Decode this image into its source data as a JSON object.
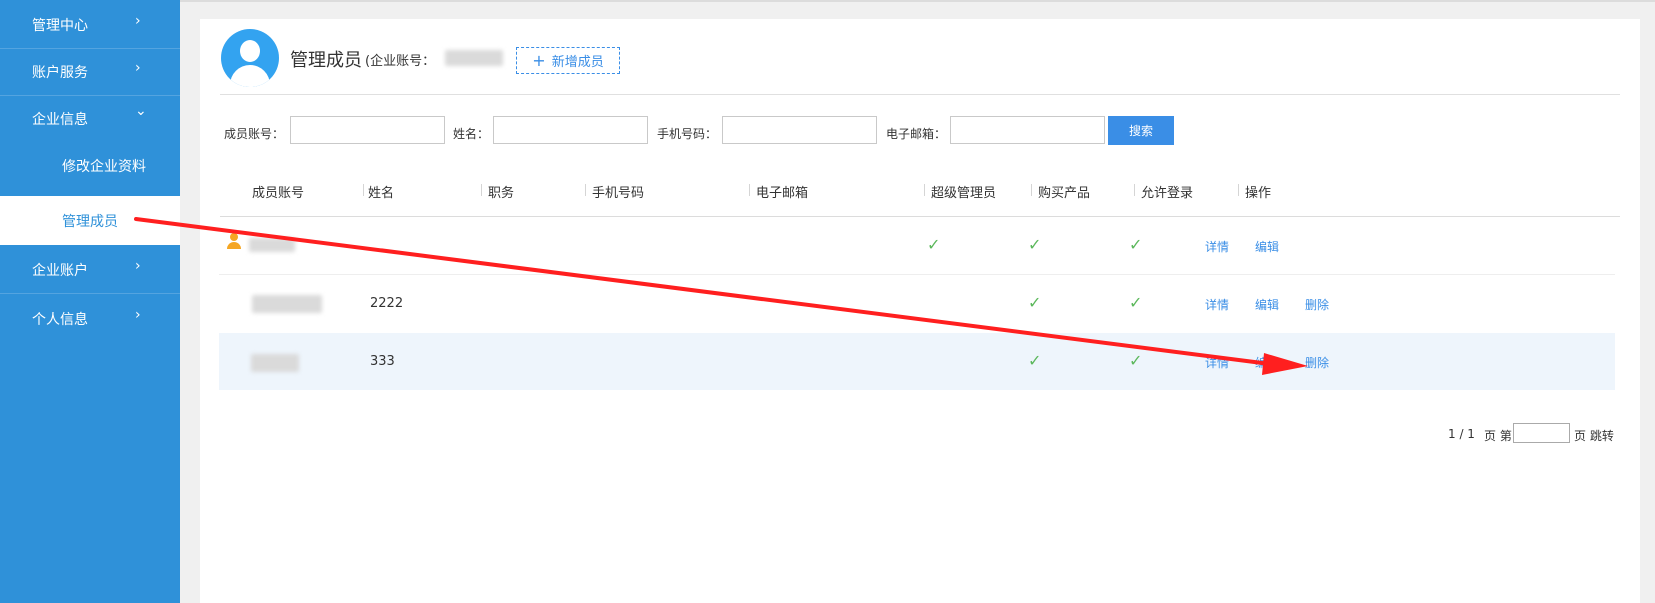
{
  "sidebar": {
    "items": [
      {
        "label": "管理中心",
        "chevron": "›"
      },
      {
        "label": "账户服务",
        "chevron": "›"
      },
      {
        "label": "企业信息",
        "chevron": "⌄"
      },
      {
        "label": "修改企业资料"
      },
      {
        "label": "管理成员"
      },
      {
        "label": "企业账户",
        "chevron": "›"
      },
      {
        "label": "个人信息",
        "chevron": "›"
      }
    ]
  },
  "header": {
    "title": "管理成员",
    "account_label": "(企业账号：",
    "add_button": "新增成员",
    "add_icon": "+"
  },
  "search": {
    "member_account_label": "成员账号：",
    "name_label": "姓名：",
    "phone_label": "手机号码：",
    "email_label": "电子邮箱：",
    "member_account_value": "",
    "name_value": "",
    "phone_value": "",
    "email_value": "",
    "button": "搜索"
  },
  "table": {
    "columns": [
      "成员账号",
      "姓名",
      "职务",
      "手机号码",
      "电子邮箱",
      "超级管理员",
      "购买产品",
      "允许登录",
      "操作"
    ],
    "check_glyph": "✓",
    "rows": [
      {
        "name": "",
        "super_admin": true,
        "buy_product": true,
        "allow_login": true,
        "actions": [
          "详情",
          "编辑"
        ]
      },
      {
        "name": "2222",
        "super_admin": false,
        "buy_product": true,
        "allow_login": true,
        "actions": [
          "详情",
          "编辑",
          "删除"
        ]
      },
      {
        "name": "333",
        "super_admin": false,
        "buy_product": true,
        "allow_login": true,
        "actions": [
          "详情",
          "编辑",
          "删除"
        ]
      }
    ]
  },
  "pagination": {
    "page_info": "1 / 1",
    "page_prefix": "页 第",
    "page_suffix": "页 跳转",
    "page_input_value": ""
  },
  "colors": {
    "sidebar": "#2f91d9",
    "accent": "#3a8ee6",
    "check": "#5cb85c",
    "annotation_arrow": "#ff1f1f"
  }
}
